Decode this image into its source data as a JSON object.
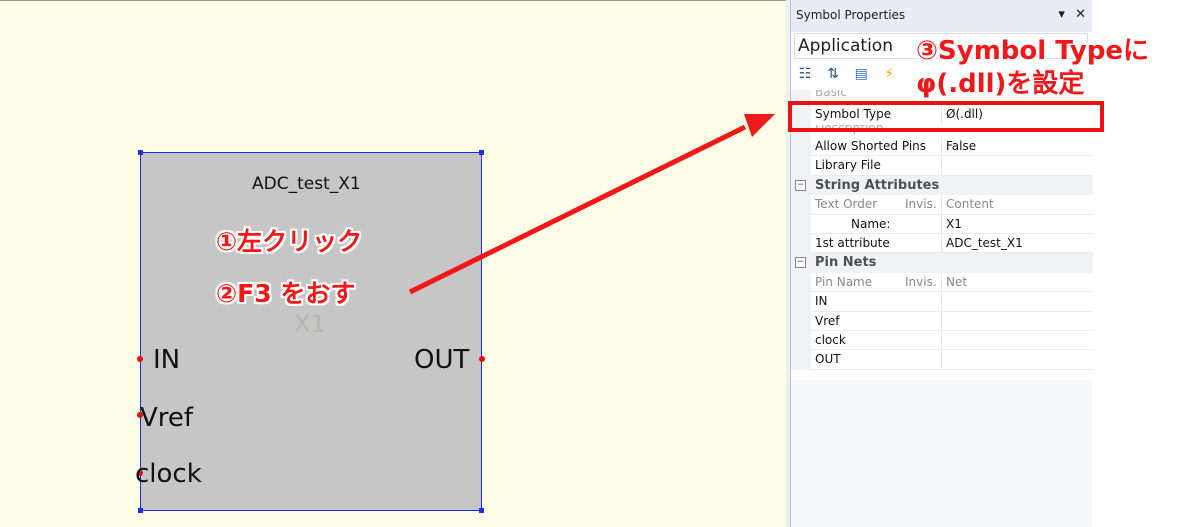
{
  "schematic": {
    "symbol_name": "ADC_test_X1",
    "symbol_ref": "X1",
    "pins": [
      "IN",
      "OUT",
      "Vref",
      "clock"
    ]
  },
  "annotations": {
    "step1": "①左クリック",
    "step2": "②F3 をおす",
    "step3_line1": "③Symbol Typeに",
    "step3_line2": "φ(.dll)を設定"
  },
  "panel": {
    "title": "Symbol Properties",
    "title_buttons": [
      "▾",
      "✕"
    ],
    "object_selector": "Application",
    "toolbar_icons": [
      "categorized-icon",
      "sort-alpha-icon",
      "property-pages-icon",
      "events-icon"
    ],
    "rows": [
      {
        "kind": "faded",
        "name": "Basic",
        "value": ""
      },
      {
        "kind": "selected",
        "name": "Symbol Type",
        "value": "Ø(.dll)"
      },
      {
        "kind": "faded",
        "name": "Description",
        "value": ""
      },
      {
        "kind": "normal",
        "name": "Allow Shorted Pins",
        "value": "False"
      },
      {
        "kind": "normal",
        "name": "Library File",
        "value": ""
      }
    ],
    "string_attributes": {
      "category": "String Attributes",
      "header": {
        "name": "Text Order",
        "mid": "Invis.",
        "value": "Content"
      },
      "rows": [
        {
          "name": "Name:",
          "value": "X1"
        },
        {
          "name": "1st attribute",
          "value": "ADC_test_X1"
        }
      ]
    },
    "pin_nets": {
      "category": "Pin Nets",
      "header": {
        "name": "Pin Name",
        "mid": "Invis.",
        "value": "Net"
      },
      "rows": [
        {
          "name": "IN",
          "value": ""
        },
        {
          "name": "Vref",
          "value": ""
        },
        {
          "name": "clock",
          "value": ""
        },
        {
          "name": "OUT",
          "value": ""
        }
      ]
    }
  },
  "colors": {
    "annotation_red": "#f01818",
    "symbol_border": "#1f2fe0",
    "symbol_fill": "#c6c6c6",
    "canvas_bg": "#fefee8"
  }
}
